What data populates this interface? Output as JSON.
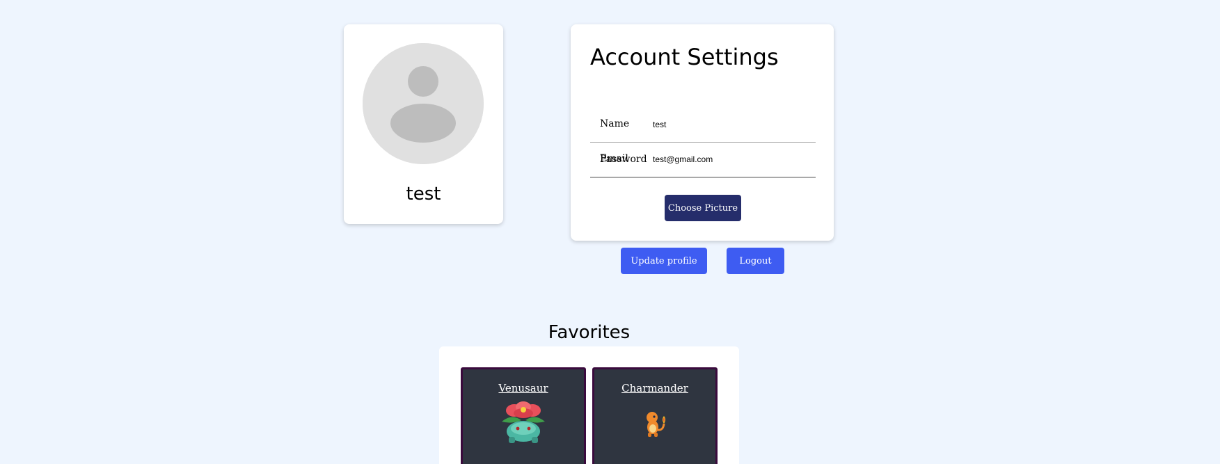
{
  "profile": {
    "name": "test",
    "avatar_icon": "user-placeholder-icon"
  },
  "settings": {
    "title": "Account Settings",
    "fields": {
      "name": {
        "label": "Name",
        "value": "test"
      },
      "email": {
        "label": "Email",
        "value": "test@gmail.com"
      },
      "password": {
        "label": "Password",
        "value": ""
      }
    },
    "choose_picture_label": "Choose Picture"
  },
  "actions": {
    "update_label": "Update profile",
    "logout_label": "Logout"
  },
  "favorites": {
    "title": "Favorites",
    "items": [
      {
        "name": "Venusaur",
        "sprite_icon": "venusaur-sprite-icon"
      },
      {
        "name": "Charmander",
        "sprite_icon": "charmander-sprite-icon"
      }
    ]
  },
  "colors": {
    "background": "#eef5fe",
    "choose_button": "#252d6b",
    "action_button": "#3e5cf2",
    "poke_card": "#2f3540",
    "poke_card_border": "#3a0a3d"
  }
}
